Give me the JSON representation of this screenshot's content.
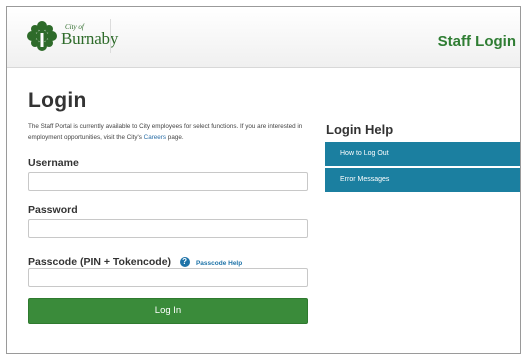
{
  "header": {
    "logo_small": "City of",
    "logo_big": "Burnaby",
    "page_label": "Staff Login"
  },
  "login": {
    "title": "Login",
    "intro_text": "The Staff Portal is currently available to City employees for select functions. If you are interested in employment opportunities, visit the City's ",
    "intro_link": "Careers",
    "intro_tail": " page.",
    "username_label": "Username",
    "password_label": "Password",
    "passcode_label": "Passcode (PIN + Tokencode)",
    "passcode_help": "Passcode Help",
    "submit_label": "Log In"
  },
  "help": {
    "title": "Login Help",
    "items": [
      {
        "label": "How to Log Out"
      },
      {
        "label": "Error Messages"
      }
    ]
  },
  "colors": {
    "brand_green": "#2f7d33",
    "button_green": "#3a8b3a",
    "help_blue": "#1b7fa0"
  }
}
